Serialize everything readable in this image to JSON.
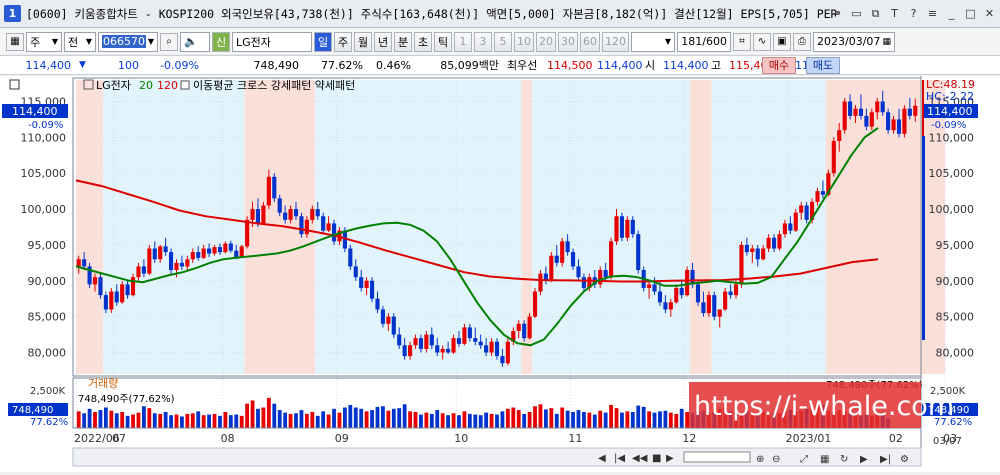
{
  "window": {
    "number": "1",
    "title": "[0600] 키움종합차트 - KOSPI200 외국인보유[43,738(천)] 주식수[163,648(천)] 액면[5,000] 자본금[8,182(억)] 결산[12월] EPS[5,705] PER[20."
  },
  "toolbar": {
    "market": "주",
    "type_label": "전",
    "code": "066570",
    "stock_name": "LG전자",
    "sin_label": "신",
    "periods": [
      "일",
      "주",
      "월",
      "년",
      "분",
      "초",
      "틱"
    ],
    "minutes": [
      "1",
      "3",
      "5",
      "10",
      "20",
      "30",
      "60",
      "120"
    ],
    "count": "181",
    "count_total": "/600",
    "date": "2023/03/07"
  },
  "infobar": {
    "price": "114,400",
    "change": "100",
    "change_pct": "-0.09%",
    "volume": "748,490",
    "vol_ratio": "77.62%",
    "turnover_pct": "0.46%",
    "amount": "85,099백만",
    "best_ask_label": "최우선",
    "best_ask": "114,500",
    "best_bid": "114,400",
    "open_label": "시",
    "open": "114,400",
    "high_label": "고",
    "high": "115,400",
    "low_label": "저",
    "low": "112,200",
    "buy_label": "매수",
    "sell_label": "매도"
  },
  "legend": {
    "name": "LG전자",
    "ma1": "20",
    "ma2": "120",
    "pattern_text": "이동평균 크로스 강세패턴  약세패턴"
  },
  "price_axis": {
    "ticks": [
      "115,000",
      "110,000",
      "105,000",
      "100,000",
      "95,000",
      "90,000",
      "85,000",
      "80,000"
    ],
    "current_tag": "114,400",
    "current_pct": "-0.09%",
    "lc_label": "LC:48.19",
    "hc_label": "HC:-2.22"
  },
  "volume_panel": {
    "title": "거래량",
    "value_text": "748,490주(77.62%)",
    "right_text": "748,490주(77.62%)",
    "tick": "2,500K",
    "tag": "748,490",
    "tag_pct": "77.62%"
  },
  "x_axis": {
    "labels": [
      "2022/06",
      "07",
      "08",
      "09",
      "10",
      "11",
      "12",
      "2023/01",
      "02",
      "03"
    ],
    "end_label": "03/07"
  },
  "watermark": "https://i-whale.com",
  "colors": {
    "up": "#e60000",
    "down": "#0033cc",
    "ma20": "#008000",
    "ma120": "#dd0000",
    "bull_bg": "#fbe0da",
    "bear_bg": "#e2f4fb"
  },
  "chart_data": {
    "type": "candlestick",
    "series": [
      {
        "name": "LG전자",
        "type": "ohlc"
      },
      {
        "name": "20",
        "type": "moving-average"
      },
      {
        "name": "120",
        "type": "moving-average"
      },
      {
        "name": "거래량",
        "type": "volume-bar"
      }
    ],
    "ylim": [
      77000,
      118000
    ],
    "months": [
      "2022/06",
      "07",
      "08",
      "09",
      "10",
      "11",
      "12",
      "2023/01",
      "02",
      "03"
    ],
    "candles": [
      [
        92000,
        93500,
        91000,
        93000
      ],
      [
        93000,
        94000,
        91500,
        92000
      ],
      [
        92000,
        92500,
        89000,
        89500
      ],
      [
        89500,
        91000,
        88500,
        90500
      ],
      [
        90500,
        91000,
        87500,
        88000
      ],
      [
        88000,
        88500,
        85500,
        86000
      ],
      [
        86000,
        89000,
        85500,
        88500
      ],
      [
        88500,
        89500,
        86500,
        87000
      ],
      [
        87000,
        90000,
        86800,
        89500
      ],
      [
        89500,
        90000,
        87500,
        88000
      ],
      [
        88000,
        91000,
        87800,
        90500
      ],
      [
        90500,
        92500,
        90000,
        92000
      ],
      [
        92000,
        93000,
        90500,
        91000
      ],
      [
        91000,
        95000,
        90800,
        94500
      ],
      [
        94500,
        95500,
        92500,
        93000
      ],
      [
        93000,
        95000,
        92500,
        94800
      ],
      [
        94800,
        96000,
        93500,
        94000
      ],
      [
        94000,
        94500,
        91000,
        91500
      ],
      [
        91500,
        93000,
        90500,
        92500
      ],
      [
        92500,
        93500,
        91500,
        92000
      ],
      [
        92000,
        93500,
        91500,
        93000
      ],
      [
        93000,
        94500,
        92500,
        94000
      ],
      [
        94000,
        94800,
        92800,
        93200
      ],
      [
        93200,
        95000,
        93000,
        94500
      ],
      [
        94500,
        95200,
        93300,
        93800
      ],
      [
        93800,
        95000,
        93500,
        94700
      ],
      [
        94700,
        95200,
        93600,
        94000
      ],
      [
        94000,
        95500,
        93800,
        95200
      ],
      [
        95200,
        95600,
        93900,
        94200
      ],
      [
        94200,
        95000,
        93000,
        93300
      ],
      [
        93300,
        95000,
        93200,
        94800
      ],
      [
        94800,
        99000,
        94500,
        98500
      ],
      [
        98500,
        101000,
        97500,
        100000
      ],
      [
        100000,
        101500,
        97500,
        98000
      ],
      [
        98000,
        101000,
        97800,
        100500
      ],
      [
        100500,
        105500,
        100000,
        104500
      ],
      [
        104500,
        105000,
        101000,
        101500
      ],
      [
        101500,
        102000,
        99000,
        99500
      ],
      [
        99500,
        100500,
        98000,
        98500
      ],
      [
        98500,
        100500,
        98000,
        100000
      ],
      [
        100000,
        101000,
        98500,
        99000
      ],
      [
        99000,
        99500,
        96000,
        96500
      ],
      [
        96500,
        99000,
        96000,
        98500
      ],
      [
        98500,
        100500,
        98000,
        100000
      ],
      [
        100000,
        101000,
        98500,
        99000
      ],
      [
        99000,
        99500,
        96500,
        97000
      ],
      [
        97000,
        99000,
        96800,
        98000
      ],
      [
        98000,
        98500,
        95000,
        95500
      ],
      [
        95500,
        97500,
        95000,
        97000
      ],
      [
        97000,
        97500,
        94000,
        94500
      ],
      [
        94500,
        95000,
        91500,
        92000
      ],
      [
        92000,
        93000,
        90000,
        90500
      ],
      [
        90500,
        91500,
        88500,
        89000
      ],
      [
        89000,
        90500,
        88000,
        90000
      ],
      [
        90000,
        90500,
        87000,
        87500
      ],
      [
        87500,
        88500,
        85500,
        86000
      ],
      [
        86000,
        86500,
        83500,
        84000
      ],
      [
        84000,
        85500,
        83000,
        85000
      ],
      [
        85000,
        85500,
        82000,
        82500
      ],
      [
        82500,
        83500,
        80500,
        81000
      ],
      [
        81000,
        82000,
        79000,
        79500
      ],
      [
        79500,
        81500,
        79000,
        81000
      ],
      [
        81000,
        82500,
        80500,
        82000
      ],
      [
        82000,
        82500,
        80000,
        80500
      ],
      [
        80500,
        83000,
        80000,
        82500
      ],
      [
        82500,
        83500,
        80500,
        81000
      ],
      [
        81000,
        82000,
        79500,
        80000
      ],
      [
        80000,
        81000,
        79000,
        80500
      ],
      [
        80500,
        81500,
        79800,
        80000
      ],
      [
        80000,
        82500,
        79800,
        82000
      ],
      [
        82000,
        83000,
        80800,
        81200
      ],
      [
        81200,
        84000,
        81000,
        83500
      ],
      [
        83500,
        84000,
        81500,
        82000
      ],
      [
        82000,
        83500,
        81000,
        81500
      ],
      [
        81500,
        82500,
        80500,
        81000
      ],
      [
        81000,
        82000,
        79500,
        80000
      ],
      [
        80000,
        82000,
        79500,
        81500
      ],
      [
        81500,
        82000,
        79000,
        79500
      ],
      [
        79500,
        80500,
        78000,
        78500
      ],
      [
        78500,
        82000,
        78200,
        81500
      ],
      [
        81500,
        83500,
        81000,
        83000
      ],
      [
        83000,
        84500,
        82000,
        84000
      ],
      [
        84000,
        84500,
        81500,
        82000
      ],
      [
        82000,
        85500,
        81800,
        85000
      ],
      [
        85000,
        89000,
        84800,
        88500
      ],
      [
        88500,
        91500,
        88000,
        91000
      ],
      [
        91000,
        92000,
        89500,
        90000
      ],
      [
        90000,
        94000,
        89800,
        93500
      ],
      [
        93500,
        95000,
        92000,
        92500
      ],
      [
        92500,
        96000,
        92000,
        95500
      ],
      [
        95500,
        96500,
        93500,
        94000
      ],
      [
        94000,
        94500,
        91500,
        92000
      ],
      [
        92000,
        93000,
        90000,
        90500
      ],
      [
        90500,
        91000,
        88500,
        89000
      ],
      [
        89000,
        91000,
        88500,
        90500
      ],
      [
        90500,
        91500,
        89000,
        89500
      ],
      [
        89500,
        92000,
        89000,
        91500
      ],
      [
        91500,
        92500,
        90000,
        90500
      ],
      [
        90500,
        96000,
        90200,
        95500
      ],
      [
        95500,
        100000,
        95000,
        99000
      ],
      [
        99000,
        99500,
        95500,
        96000
      ],
      [
        96000,
        99000,
        95500,
        98500
      ],
      [
        98500,
        99000,
        96000,
        96500
      ],
      [
        96500,
        97000,
        91000,
        91500
      ],
      [
        91500,
        92000,
        88500,
        89000
      ],
      [
        89000,
        90000,
        87500,
        89500
      ],
      [
        89500,
        90500,
        88000,
        88500
      ],
      [
        88500,
        90000,
        86500,
        87000
      ],
      [
        87000,
        88000,
        85500,
        86000
      ],
      [
        86000,
        87500,
        85000,
        87000
      ],
      [
        87000,
        89500,
        86800,
        89000
      ],
      [
        89000,
        90000,
        87500,
        88000
      ],
      [
        88000,
        92000,
        87800,
        91500
      ],
      [
        91500,
        92500,
        89000,
        89500
      ],
      [
        89500,
        90000,
        86500,
        87000
      ],
      [
        87000,
        88500,
        85000,
        85500
      ],
      [
        85500,
        88500,
        85000,
        88000
      ],
      [
        88000,
        88500,
        84500,
        85000
      ],
      [
        85000,
        86000,
        83500,
        86000
      ],
      [
        86000,
        89000,
        85800,
        88500
      ],
      [
        88500,
        89500,
        87500,
        88000
      ],
      [
        88000,
        90000,
        87500,
        89500
      ],
      [
        89500,
        95500,
        89000,
        95000
      ],
      [
        95000,
        96000,
        93500,
        94000
      ],
      [
        94000,
        95000,
        92500,
        94500
      ],
      [
        94500,
        95000,
        92000,
        93000
      ],
      [
        93000,
        95000,
        92800,
        94500
      ],
      [
        94500,
        96500,
        94000,
        96000
      ],
      [
        96000,
        96500,
        94000,
        94500
      ],
      [
        94500,
        97000,
        94200,
        96500
      ],
      [
        96500,
        98500,
        96000,
        98000
      ],
      [
        98000,
        99000,
        96500,
        97000
      ],
      [
        97000,
        100000,
        96800,
        99500
      ],
      [
        99500,
        101000,
        98500,
        100500
      ],
      [
        100500,
        101000,
        98000,
        98500
      ],
      [
        98500,
        101500,
        98000,
        101000
      ],
      [
        101000,
        103000,
        100500,
        102500
      ],
      [
        102500,
        104000,
        101500,
        102000
      ],
      [
        102000,
        105500,
        101800,
        105000
      ],
      [
        105000,
        110000,
        104500,
        109500
      ],
      [
        109500,
        112000,
        108000,
        111000
      ],
      [
        111000,
        115500,
        110500,
        115000
      ],
      [
        115000,
        116000,
        112500,
        113000
      ],
      [
        113000,
        114500,
        112000,
        114000
      ],
      [
        114000,
        116000,
        112500,
        113000
      ],
      [
        113000,
        114000,
        111000,
        111500
      ],
      [
        111500,
        114000,
        111000,
        113500
      ],
      [
        113500,
        115500,
        112500,
        115000
      ],
      [
        115000,
        116500,
        113000,
        113500
      ],
      [
        113500,
        114000,
        110500,
        111000
      ],
      [
        111000,
        113000,
        110500,
        112500
      ],
      [
        112500,
        114000,
        110000,
        110500
      ],
      [
        110500,
        114500,
        110000,
        114000
      ],
      [
        114000,
        115500,
        112500,
        113000
      ],
      [
        113000,
        115400,
        112200,
        114400
      ]
    ],
    "ma20": [
      92000,
      91500,
      91000,
      90500,
      90000,
      89800,
      90300,
      90800,
      91200,
      91800,
      92500,
      93000,
      93200,
      93400,
      93600,
      93800,
      94200,
      94800,
      95500,
      96200,
      96800,
      97300,
      97700,
      98000,
      98100,
      97800,
      97000,
      95500,
      93000,
      90000,
      87000,
      84500,
      82500,
      81300,
      81000,
      81800,
      84000,
      86500,
      88500,
      90000,
      90600,
      90700,
      90500,
      90000,
      89300,
      89300,
      89600,
      89800,
      90000,
      89800,
      89600,
      89700,
      90500,
      93000,
      95500,
      98500,
      101500,
      104500,
      107500,
      110000,
      111300
    ],
    "ma120": [
      104000,
      103200,
      102100,
      101000,
      99800,
      99000,
      98500,
      98000,
      97600,
      97000,
      96300,
      95300,
      94200,
      93200,
      92200,
      91200,
      90600,
      90300,
      90100,
      90050,
      90000,
      89900,
      89900,
      90000,
      90050,
      90100,
      90300,
      90600,
      91000,
      91800,
      92600,
      93000
    ],
    "volumes_k": [
      1300,
      1150,
      1500,
      1250,
      1400,
      1600,
      1350,
      1150,
      1250,
      950,
      1050,
      1200,
      1700,
      1550,
      1150,
      1100,
      1250,
      1000,
      1050,
      900,
      1100,
      1150,
      1300,
      1000,
      1050,
      1100,
      950,
      1250,
      1000,
      1050,
      950,
      1900,
      2150,
      1500,
      1600,
      2350,
      1900,
      1400,
      1200,
      1100,
      1150,
      1400,
      1100,
      1250,
      950,
      1300,
      1050,
      1500,
      1200,
      1600,
      1800,
      1600,
      1500,
      1300,
      1400,
      1650,
      1700,
      1350,
      1500,
      1550,
      1850,
      1300,
      1250,
      1050,
      1200,
      1100,
      1400,
      1150,
      1000,
      1150,
      1000,
      1300,
      1100,
      1050,
      1000,
      1200,
      1100,
      1050,
      1300,
      1500,
      1600,
      1400,
      1100,
      1250,
      1700,
      1850,
      1450,
      1550,
      1100,
      1600,
      1350,
      1250,
      1400,
      1250,
      1200,
      1050,
      1350,
      1200,
      1800,
      1550,
      1200,
      1300,
      1250,
      1750,
      1650,
      1300,
      1200,
      1300,
      1350,
      1200,
      1100,
      1500,
      1250,
      1200,
      1300,
      1350,
      1150,
      1250,
      1500,
      1650,
      1300,
      1250,
      1100,
      1350,
      1200,
      1150,
      1250,
      1300,
      1200,
      1150,
      1300,
      1400,
      1250,
      1350,
      1500,
      1450,
      1650,
      1850,
      1350,
      1250,
      1400,
      1300,
      1150,
      1100,
      1000,
      1050,
      950,
      1100,
      1000,
      748
    ],
    "bull_zones": [
      [
        0,
        5
      ],
      [
        31,
        44
      ],
      [
        82,
        84
      ],
      [
        113,
        115
      ],
      [
        114,
        117
      ],
      [
        138,
        160
      ]
    ],
    "bear_zones": [
      [
        5,
        31
      ],
      [
        44,
        82
      ],
      [
        84,
        113
      ],
      [
        117,
        138
      ]
    ]
  }
}
